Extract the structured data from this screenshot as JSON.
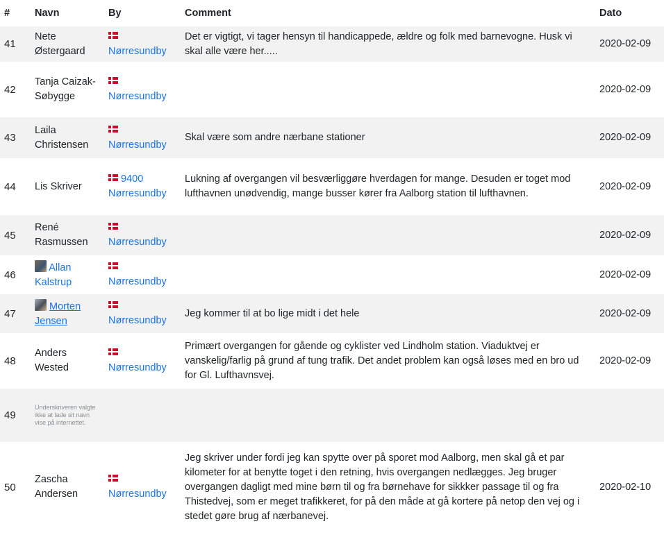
{
  "headers": {
    "num": "#",
    "name": "Navn",
    "city": "By",
    "comment": "Comment",
    "date": "Dato"
  },
  "rows": [
    {
      "num": "41",
      "name": "Nete Østergaard",
      "city": "Nørresundby",
      "comment": "Det er vigtigt, vi tager hensyn til handicappede, ældre og folk med barnevogne. Husk vi skal alle være her.....",
      "date": "2020-02-09"
    },
    {
      "num": "42",
      "name": "Tanja Caizak-Søbygge",
      "city": "Nørresundby",
      "comment": "",
      "date": "2020-02-09"
    },
    {
      "num": "43",
      "name": "Laila Christensen",
      "city": "Nørresundby",
      "comment": "Skal være som andre nærbane stationer",
      "date": "2020-02-09"
    },
    {
      "num": "44",
      "name": "Lis Skriver",
      "postcode": "9400",
      "city": "Nørresundby",
      "comment": "Lukning af overgangen vil besværliggøre hverdagen for mange. Desuden er toget mod lufthavnen unødvendig, mange busser kører fra Aalborg station til lufthavnen.",
      "date": "2020-02-09"
    },
    {
      "num": "45",
      "name": "René Rasmussen",
      "city": "Nørresundby",
      "comment": "",
      "date": "2020-02-09"
    },
    {
      "num": "46",
      "name": "Allan Kalstrup",
      "city": "Nørresundby",
      "comment": "",
      "date": "2020-02-09"
    },
    {
      "num": "47",
      "name": "Morten Jensen",
      "city": "Nørresundby",
      "comment": "Jeg kommer til at bo lige midt i det hele",
      "date": "2020-02-09"
    },
    {
      "num": "48",
      "name": "Anders Wested",
      "city": "Nørresundby",
      "comment": "Primært overgangen for gående og cyklister ved Lindholm station. Viaduktvej er vanskelig/farlig på grund af tung trafik. Det andet problem kan også løses med en bro ud for Gl. Lufthavnsvej.",
      "date": "2020-02-09"
    },
    {
      "num": "49",
      "name": "Underskriveren valgte ikke at lade sit navn vise på internettet.",
      "city": "",
      "comment": "",
      "date": ""
    },
    {
      "num": "50",
      "name": "Zascha Andersen",
      "city": "Nørresundby",
      "comment": "Jeg skriver under fordi jeg kan spytte over på sporet mod Aalborg, men skal gå et par kilometer for at benytte toget i den retning, hvis overgangen nedlægges. Jeg bruger overgangen dagligt med mine børn til og fra børnehave for sikkker passage til og fra Thistedvej, som er meget trafikkeret, for på den måde at gå kortere på netop den vej og i stedet gøre brug af nærbanevej.",
      "date": "2020-02-10"
    }
  ],
  "colors": {
    "link": "#1a73e8",
    "stripe": "#f2f2f2",
    "flag": "#c8102e"
  },
  "icons": {
    "flag": "denmark-flag-icon",
    "avatar": "user-avatar"
  }
}
